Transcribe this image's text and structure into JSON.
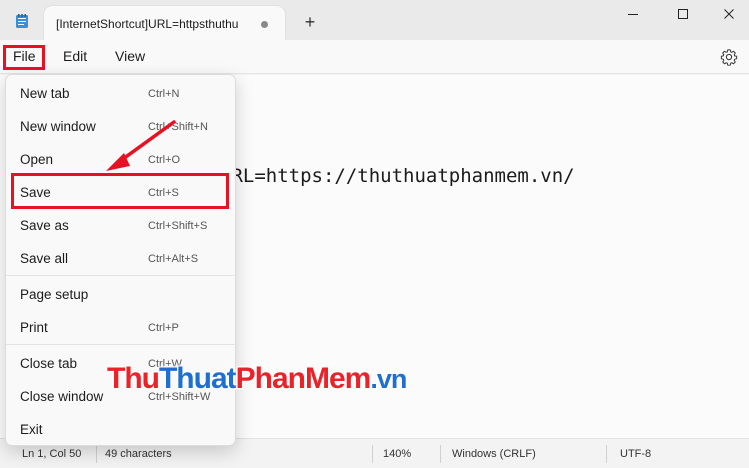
{
  "window": {
    "tab_title": "[InternetShortcut]URL=httpsthuthu",
    "new_tab_symbol": "+"
  },
  "menubar": {
    "file": "File",
    "edit": "Edit",
    "view": "View"
  },
  "editor": {
    "content": "URL=https://thuthuatphanmem.vn/"
  },
  "file_menu": {
    "items": [
      {
        "label": "New tab",
        "shortcut": "Ctrl+N"
      },
      {
        "label": "New window",
        "shortcut": "Ctrl+Shift+N"
      },
      {
        "label": "Open",
        "shortcut": "Ctrl+O"
      },
      {
        "label": "Save",
        "shortcut": "Ctrl+S"
      },
      {
        "label": "Save as",
        "shortcut": "Ctrl+Shift+S"
      },
      {
        "label": "Save all",
        "shortcut": "Ctrl+Alt+S"
      },
      {
        "label": "Page setup",
        "shortcut": ""
      },
      {
        "label": "Print",
        "shortcut": "Ctrl+P"
      },
      {
        "label": "Close tab",
        "shortcut": "Ctrl+W"
      },
      {
        "label": "Close window",
        "shortcut": "Ctrl+Shift+W"
      },
      {
        "label": "Exit",
        "shortcut": ""
      }
    ]
  },
  "statusbar": {
    "position": "Ln 1, Col 50",
    "characters": "49 characters",
    "zoom": "140%",
    "line_ending": "Windows (CRLF)",
    "encoding": "UTF-8"
  },
  "watermark": {
    "part1": "Thu",
    "part2": "Thuat",
    "part3": "PhanMem",
    "part4": ".vn"
  },
  "colors": {
    "highlight": "#e81123",
    "watermark_red": "#e8232a",
    "watermark_blue": "#1f6fd1"
  },
  "icons": {
    "app": "notepad-icon",
    "settings": "gear-icon",
    "minimize": "minimize-icon",
    "maximize": "maximize-icon",
    "close": "close-icon"
  }
}
